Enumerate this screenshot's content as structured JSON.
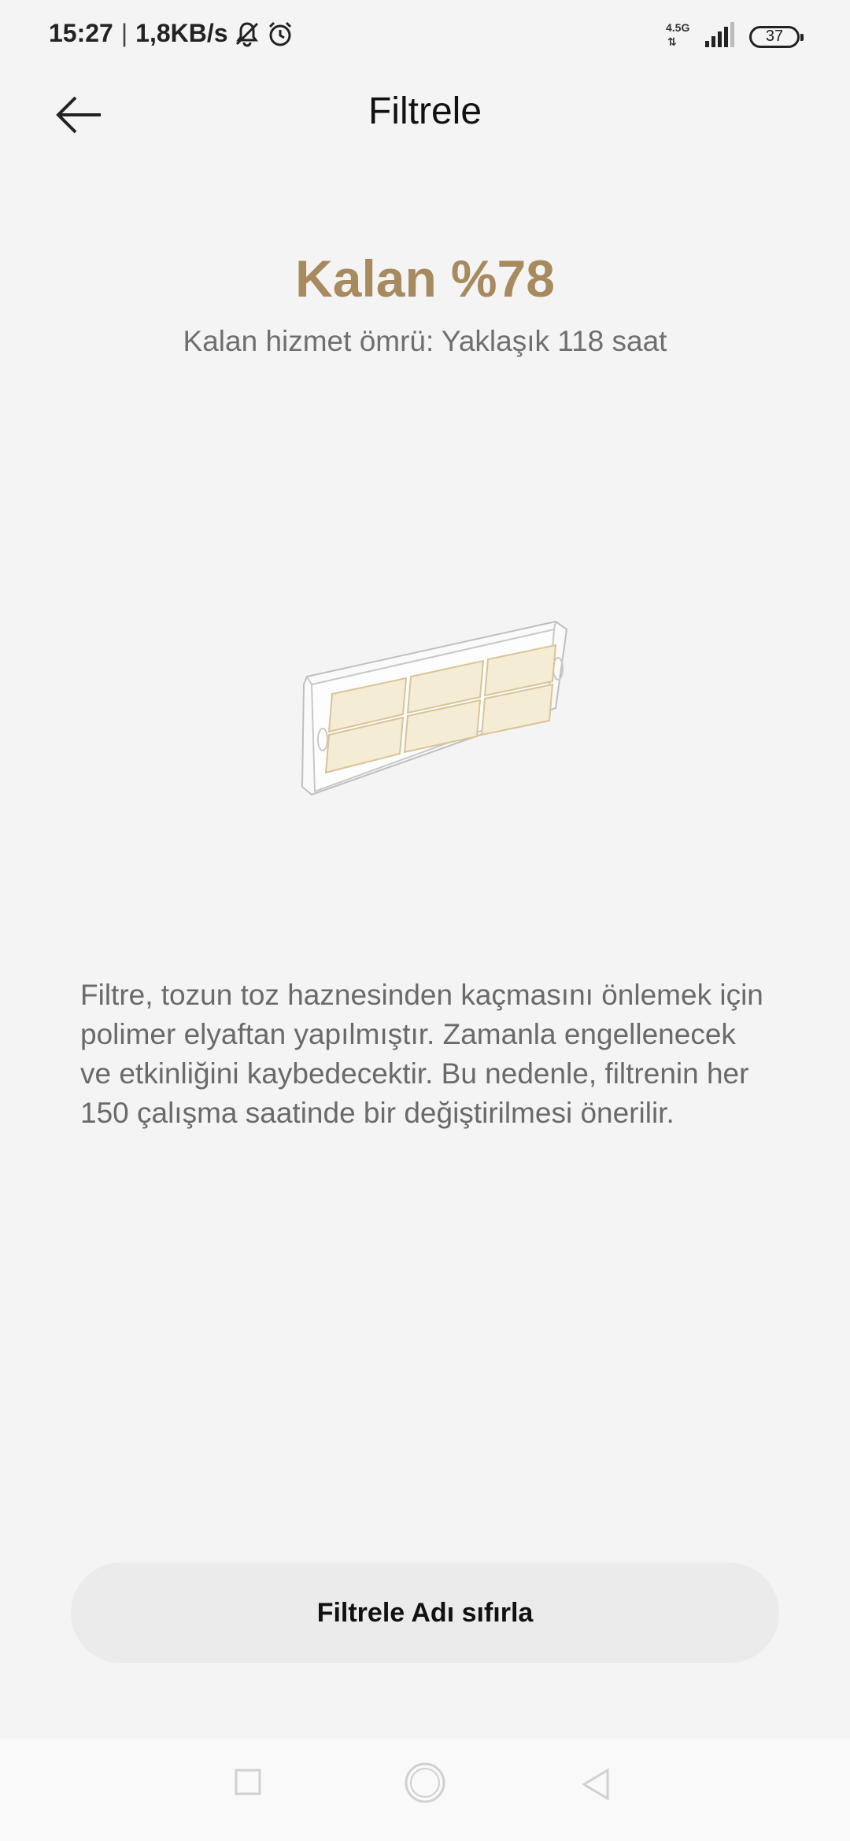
{
  "status_bar": {
    "time": "15:27",
    "network_speed": "1,8KB/s",
    "network_type": "4.5G",
    "battery": "37",
    "icons": [
      "bell-off-icon",
      "alarm-icon",
      "signal-icon",
      "battery-icon"
    ]
  },
  "header": {
    "title": "Filtrele",
    "back_icon": "arrow-left-icon"
  },
  "summary": {
    "remaining_label": "Kalan",
    "remaining_percent": "%78",
    "service_life": "Kalan hizmet ömrü: Yaklaşık 118 saat"
  },
  "illustration": {
    "icon": "filter-icon"
  },
  "description": "Filtre, tozun toz haznesinden kaçmasını önlemek için polimer elyaftan yapılmıştır. Zamanla engellenecek ve etkinliğini kaybedecektir. Bu nedenle, filtrenin her 150 çalışma saatinde bir değiştirilmesi önerilir.",
  "actions": {
    "reset_label": "Filtrele Adı sıfırla"
  },
  "nav_bar": {
    "icons": [
      "recents-square-icon",
      "home-circle-icon",
      "back-triangle-icon"
    ]
  },
  "colors": {
    "accent": "#a88a5f",
    "background": "#f4f4f4",
    "button_bg": "#ebebeb",
    "filter_pad": "#f5ecd6"
  }
}
